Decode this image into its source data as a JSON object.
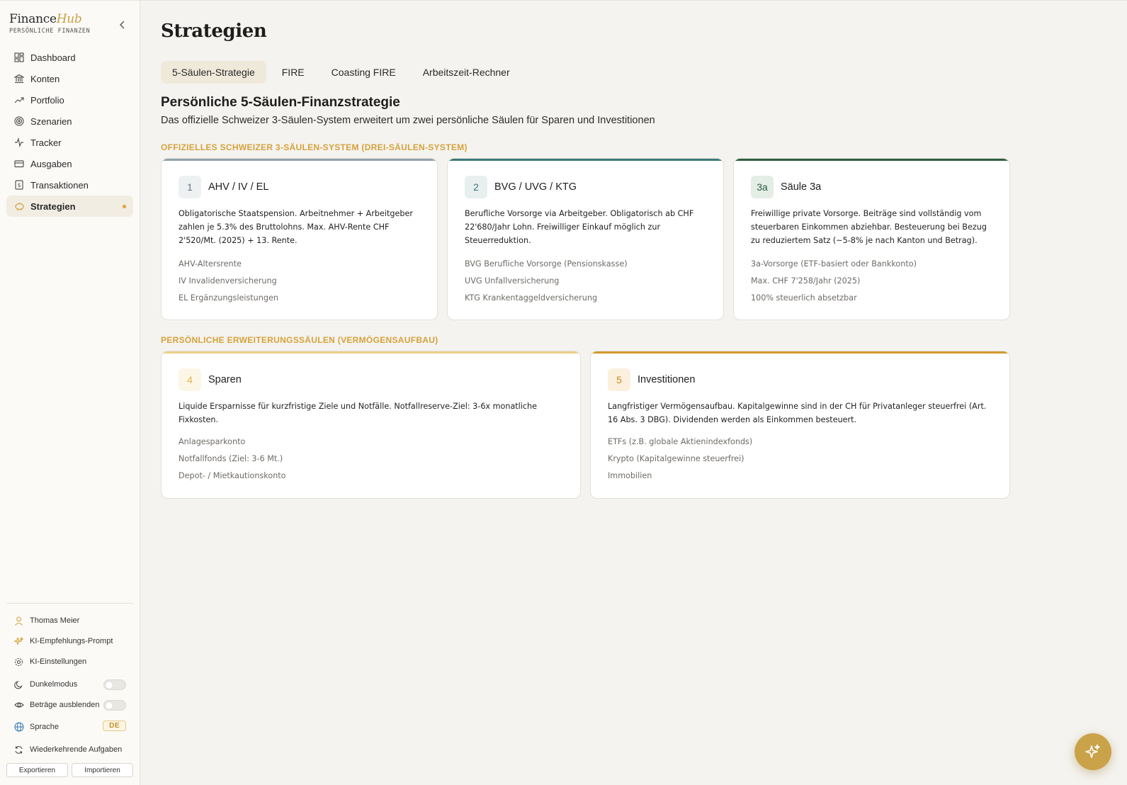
{
  "brand": {
    "name_part1": "Finance",
    "name_part2": "Hub",
    "subtitle": "PERSÖNLICHE FINANZEN"
  },
  "sidebar": {
    "items": [
      {
        "label": "Dashboard",
        "icon": "dashboard-icon"
      },
      {
        "label": "Konten",
        "icon": "bank-icon"
      },
      {
        "label": "Portfolio",
        "icon": "trending-up-icon"
      },
      {
        "label": "Szenarien",
        "icon": "target-icon"
      },
      {
        "label": "Tracker",
        "icon": "activity-icon"
      },
      {
        "label": "Ausgaben",
        "icon": "credit-card-icon"
      },
      {
        "label": "Transaktionen",
        "icon": "receipt-icon"
      },
      {
        "label": "Strategien",
        "icon": "piggy-bank-icon",
        "active": true
      }
    ],
    "user": "Thomas Meier",
    "ki_prompt": "KI-Empfehlungs-Prompt",
    "ki_settings": "KI-Einstellungen",
    "dark_mode": "Dunkelmodus",
    "hide_amounts": "Beträge ausblenden",
    "language_label": "Sprache",
    "language_value": "DE",
    "recurring": "Wiederkehrende Aufgaben",
    "export": "Exportieren",
    "import": "Importieren"
  },
  "page": {
    "title": "Strategien",
    "tabs": [
      "5-Säulen-Strategie",
      "FIRE",
      "Coasting FIRE",
      "Arbeitszeit-Rechner"
    ],
    "active_tab": 0,
    "section_title": "Persönliche 5-Säulen-Finanzstrategie",
    "section_subtitle": "Das offizielle Schweizer 3-Säulen-System erweitert um zwei persönliche Säulen für Sparen und Investitionen",
    "official_label": "OFFIZIELLES SCHWEIZER 3-SÄULEN-SYSTEM (DREI-SÄULEN-SYSTEM)",
    "personal_label": "PERSÖNLICHE ERWEITERUNGSSÄULEN (VERMÖGENSAUFBAU)"
  },
  "pillars": [
    {
      "number": "1",
      "title": "AHV / IV / EL",
      "accent": "#8fa2a8",
      "badge_bg": "#eef1f2",
      "badge_fg": "#5e7680",
      "description": "Obligatorische Staatspension. Arbeitnehmer + Arbeitgeber zahlen je 5.3% des Bruttolohns. Max. AHV-Rente CHF 2'520/Mt. (2025) + 13. Rente.",
      "items": [
        "AHV-Altersrente",
        "IV Invalidenversicherung",
        "EL Ergänzungsleistungen"
      ]
    },
    {
      "number": "2",
      "title": "BVG / UVG / KTG",
      "accent": "#3c7a79",
      "badge_bg": "#e8f0ef",
      "badge_fg": "#3c7a79",
      "description": "Berufliche Vorsorge via Arbeitgeber. Obligatorisch ab CHF 22'680/Jahr Lohn. Freiwilliger Einkauf möglich zur Steuerreduktion.",
      "items": [
        "BVG Berufliche Vorsorge (Pensionskasse)",
        "UVG Unfallversicherung",
        "KTG Krankentaggeldversicherung"
      ]
    },
    {
      "number": "3a",
      "title": "Säule 3a",
      "accent": "#2c5e3f",
      "badge_bg": "#e4ede6",
      "badge_fg": "#2c5e3f",
      "description": "Freiwillige private Vorsorge. Beiträge sind vollständig vom steuerbaren Einkommen abziehbar. Besteuerung bei Bezug zu reduziertem Satz (~5-8% je nach Kanton und Betrag).",
      "items": [
        "3a-Vorsorge (ETF-basiert oder Bankkonto)",
        "Max. CHF 7'258/Jahr (2025)",
        "100% steuerlich absetzbar"
      ]
    },
    {
      "number": "4",
      "title": "Sparen",
      "accent": "#ecd08c",
      "badge_bg": "#fcf6e6",
      "badge_fg": "#e2b24c",
      "description": "Liquide Ersparnisse für kurzfristige Ziele und Notfälle. Notfallreserve-Ziel: 3-6x monatliche Fixkosten.",
      "items": [
        "Anlagesparkonto",
        "Notfallfonds (Ziel: 3-6 Mt.)",
        "Depot- / Mietkautionskonto"
      ]
    },
    {
      "number": "5",
      "title": "Investitionen",
      "accent": "#d19a2e",
      "badge_bg": "#fbf0de",
      "badge_fg": "#c98a1e",
      "description": "Langfristiger Vermögensaufbau. Kapitalgewinne sind in der CH für Privatanleger steuerfrei (Art. 16 Abs. 3 DBG). Dividenden werden als Einkommen besteuert.",
      "items": [
        "ETFs (z.B. globale Aktienindexfonds)",
        "Krypto (Kapitalgewinne steuerfrei)",
        "Immobilien"
      ]
    }
  ],
  "colors": {
    "accent_gold": "#c9a24a",
    "label_gold": "#d6a23c",
    "background": "#f4f3ef"
  }
}
